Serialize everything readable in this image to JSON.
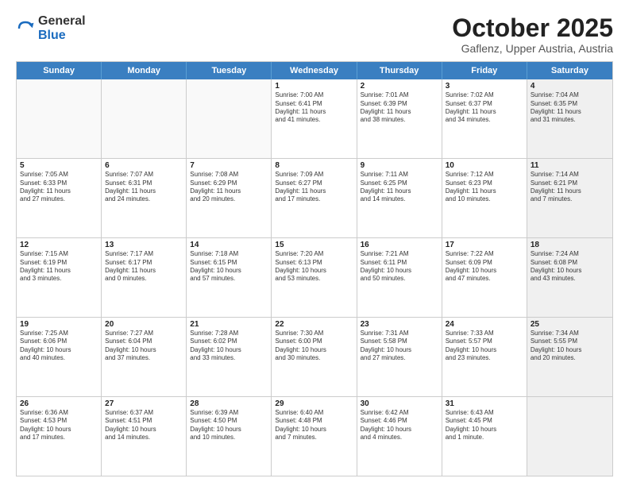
{
  "logo": {
    "general": "General",
    "blue": "Blue"
  },
  "title": "October 2025",
  "subtitle": "Gaflenz, Upper Austria, Austria",
  "header_days": [
    "Sunday",
    "Monday",
    "Tuesday",
    "Wednesday",
    "Thursday",
    "Friday",
    "Saturday"
  ],
  "weeks": [
    [
      {
        "day": "",
        "content": "",
        "empty": true
      },
      {
        "day": "",
        "content": "",
        "empty": true
      },
      {
        "day": "",
        "content": "",
        "empty": true
      },
      {
        "day": "1",
        "content": "Sunrise: 7:00 AM\nSunset: 6:41 PM\nDaylight: 11 hours\nand 41 minutes.",
        "empty": false
      },
      {
        "day": "2",
        "content": "Sunrise: 7:01 AM\nSunset: 6:39 PM\nDaylight: 11 hours\nand 38 minutes.",
        "empty": false
      },
      {
        "day": "3",
        "content": "Sunrise: 7:02 AM\nSunset: 6:37 PM\nDaylight: 11 hours\nand 34 minutes.",
        "empty": false
      },
      {
        "day": "4",
        "content": "Sunrise: 7:04 AM\nSunset: 6:35 PM\nDaylight: 11 hours\nand 31 minutes.",
        "empty": false,
        "shaded": true
      }
    ],
    [
      {
        "day": "5",
        "content": "Sunrise: 7:05 AM\nSunset: 6:33 PM\nDaylight: 11 hours\nand 27 minutes.",
        "empty": false
      },
      {
        "day": "6",
        "content": "Sunrise: 7:07 AM\nSunset: 6:31 PM\nDaylight: 11 hours\nand 24 minutes.",
        "empty": false
      },
      {
        "day": "7",
        "content": "Sunrise: 7:08 AM\nSunset: 6:29 PM\nDaylight: 11 hours\nand 20 minutes.",
        "empty": false
      },
      {
        "day": "8",
        "content": "Sunrise: 7:09 AM\nSunset: 6:27 PM\nDaylight: 11 hours\nand 17 minutes.",
        "empty": false
      },
      {
        "day": "9",
        "content": "Sunrise: 7:11 AM\nSunset: 6:25 PM\nDaylight: 11 hours\nand 14 minutes.",
        "empty": false
      },
      {
        "day": "10",
        "content": "Sunrise: 7:12 AM\nSunset: 6:23 PM\nDaylight: 11 hours\nand 10 minutes.",
        "empty": false
      },
      {
        "day": "11",
        "content": "Sunrise: 7:14 AM\nSunset: 6:21 PM\nDaylight: 11 hours\nand 7 minutes.",
        "empty": false,
        "shaded": true
      }
    ],
    [
      {
        "day": "12",
        "content": "Sunrise: 7:15 AM\nSunset: 6:19 PM\nDaylight: 11 hours\nand 3 minutes.",
        "empty": false
      },
      {
        "day": "13",
        "content": "Sunrise: 7:17 AM\nSunset: 6:17 PM\nDaylight: 11 hours\nand 0 minutes.",
        "empty": false
      },
      {
        "day": "14",
        "content": "Sunrise: 7:18 AM\nSunset: 6:15 PM\nDaylight: 10 hours\nand 57 minutes.",
        "empty": false
      },
      {
        "day": "15",
        "content": "Sunrise: 7:20 AM\nSunset: 6:13 PM\nDaylight: 10 hours\nand 53 minutes.",
        "empty": false
      },
      {
        "day": "16",
        "content": "Sunrise: 7:21 AM\nSunset: 6:11 PM\nDaylight: 10 hours\nand 50 minutes.",
        "empty": false
      },
      {
        "day": "17",
        "content": "Sunrise: 7:22 AM\nSunset: 6:09 PM\nDaylight: 10 hours\nand 47 minutes.",
        "empty": false
      },
      {
        "day": "18",
        "content": "Sunrise: 7:24 AM\nSunset: 6:08 PM\nDaylight: 10 hours\nand 43 minutes.",
        "empty": false,
        "shaded": true
      }
    ],
    [
      {
        "day": "19",
        "content": "Sunrise: 7:25 AM\nSunset: 6:06 PM\nDaylight: 10 hours\nand 40 minutes.",
        "empty": false
      },
      {
        "day": "20",
        "content": "Sunrise: 7:27 AM\nSunset: 6:04 PM\nDaylight: 10 hours\nand 37 minutes.",
        "empty": false
      },
      {
        "day": "21",
        "content": "Sunrise: 7:28 AM\nSunset: 6:02 PM\nDaylight: 10 hours\nand 33 minutes.",
        "empty": false
      },
      {
        "day": "22",
        "content": "Sunrise: 7:30 AM\nSunset: 6:00 PM\nDaylight: 10 hours\nand 30 minutes.",
        "empty": false
      },
      {
        "day": "23",
        "content": "Sunrise: 7:31 AM\nSunset: 5:58 PM\nDaylight: 10 hours\nand 27 minutes.",
        "empty": false
      },
      {
        "day": "24",
        "content": "Sunrise: 7:33 AM\nSunset: 5:57 PM\nDaylight: 10 hours\nand 23 minutes.",
        "empty": false
      },
      {
        "day": "25",
        "content": "Sunrise: 7:34 AM\nSunset: 5:55 PM\nDaylight: 10 hours\nand 20 minutes.",
        "empty": false,
        "shaded": true
      }
    ],
    [
      {
        "day": "26",
        "content": "Sunrise: 6:36 AM\nSunset: 4:53 PM\nDaylight: 10 hours\nand 17 minutes.",
        "empty": false
      },
      {
        "day": "27",
        "content": "Sunrise: 6:37 AM\nSunset: 4:51 PM\nDaylight: 10 hours\nand 14 minutes.",
        "empty": false
      },
      {
        "day": "28",
        "content": "Sunrise: 6:39 AM\nSunset: 4:50 PM\nDaylight: 10 hours\nand 10 minutes.",
        "empty": false
      },
      {
        "day": "29",
        "content": "Sunrise: 6:40 AM\nSunset: 4:48 PM\nDaylight: 10 hours\nand 7 minutes.",
        "empty": false
      },
      {
        "day": "30",
        "content": "Sunrise: 6:42 AM\nSunset: 4:46 PM\nDaylight: 10 hours\nand 4 minutes.",
        "empty": false
      },
      {
        "day": "31",
        "content": "Sunrise: 6:43 AM\nSunset: 4:45 PM\nDaylight: 10 hours\nand 1 minute.",
        "empty": false
      },
      {
        "day": "",
        "content": "",
        "empty": true,
        "shaded": true
      }
    ]
  ]
}
